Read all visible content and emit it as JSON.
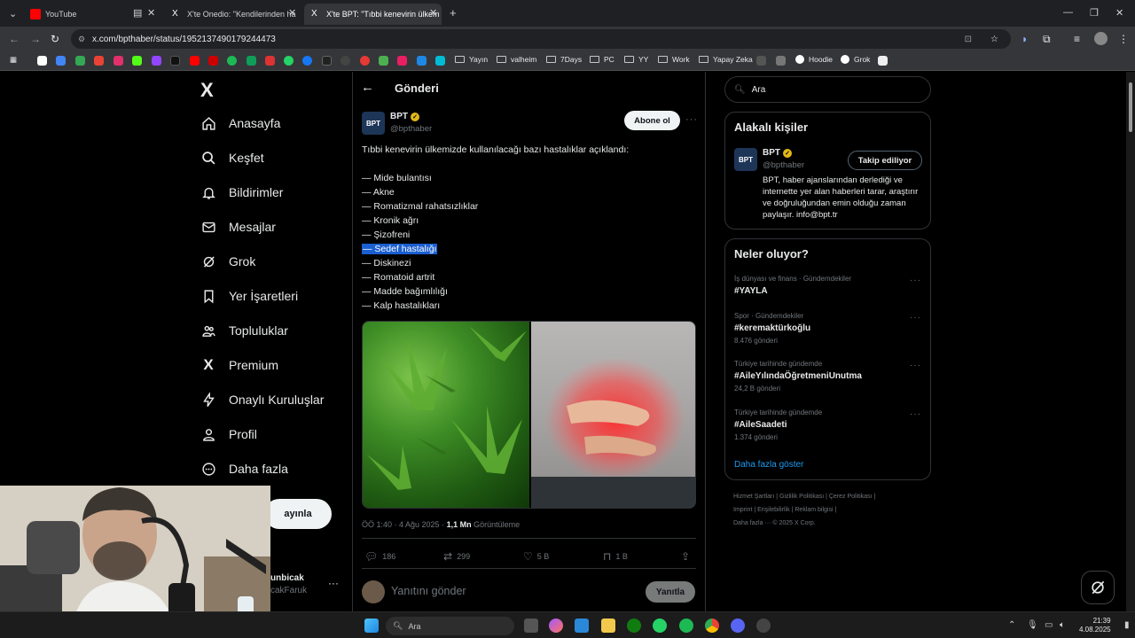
{
  "browser": {
    "tabs": [
      {
        "label": "YouTube",
        "favicon_color": "#ff0000"
      },
      {
        "label": "X'te Onedio: \"Kendilerinden ha",
        "favicon_color": "#ffffff"
      },
      {
        "label": "X'te BPT: \"Tıbbi kenevirin ülkem",
        "favicon_color": "#ffffff"
      }
    ],
    "new_tab_symbol": "+",
    "url": "x.com/bpthaber/status/1952137490179244473",
    "bookmarks": [
      "Yayın",
      "valheim",
      "7Days",
      "PC",
      "YY",
      "Work",
      "Yapay Zeka",
      "Hoodie",
      "Grok"
    ]
  },
  "sidebar": {
    "logo": "X",
    "items": [
      {
        "label": "Anasayfa",
        "icon": "home-icon"
      },
      {
        "label": "Keşfet",
        "icon": "search-icon"
      },
      {
        "label": "Bildirimler",
        "icon": "bell-icon"
      },
      {
        "label": "Mesajlar",
        "icon": "mail-icon"
      },
      {
        "label": "Grok",
        "icon": "grok-icon"
      },
      {
        "label": "Yer İşaretleri",
        "icon": "bookmark-icon"
      },
      {
        "label": "Topluluklar",
        "icon": "people-icon"
      },
      {
        "label": "Premium",
        "icon": "x-icon"
      },
      {
        "label": "Onaylı Kuruluşlar",
        "icon": "lightning-icon"
      },
      {
        "label": "Profil",
        "icon": "user-icon"
      },
      {
        "label": "Daha fazla",
        "icon": "more-circle-icon"
      }
    ],
    "post_button": "ayınla",
    "account_name": "unbicak",
    "account_handle": "cakFaruk"
  },
  "main": {
    "header_title": "Gönderi",
    "tweet": {
      "name": "BPT",
      "handle": "@bpthaber",
      "follow_label": "Abone ol",
      "intro": "Tıbbi kenevirin ülkemizde kullanılacağı bazı hastalıklar açıklandı:",
      "list": [
        "— Mide bulantısı",
        "— Akne",
        "— Romatizmal rahatsızlıklar",
        "— Kronik ağrı",
        "— Şizofreni",
        "— Sedef hastalığı",
        "— Diskinezi",
        "— Romatoid artrit",
        "— Madde bağımlılığı",
        "— Kalp hastalıkları"
      ],
      "selected_index": 5,
      "time": "ÖÖ 1:40 · 4 Ağu 2025 · ",
      "views_count": "1,1 Mn",
      "views_label": " Görüntüleme",
      "replies": "186",
      "reposts": "299",
      "likes": "5 B",
      "bookmarks": "1 B"
    },
    "reply_placeholder": "Yanıtını gönder",
    "reply_button": "Yanıtla"
  },
  "right": {
    "search_placeholder": "Ara",
    "relevant_title": "Alakalı kişiler",
    "relevant_person": {
      "name": "BPT",
      "handle": "@bpthaber",
      "follow_label": "Takip ediliyor",
      "bio": "BPT, haber ajanslarından derlediği ve internette yer alan haberleri tarar, araştırır ve doğruluğundan emin olduğu zaman paylaşır. info@bpt.tr"
    },
    "trends_title": "Neler oluyor?",
    "trends": [
      {
        "category": "İş dünyası ve finans · Gündemdekiler",
        "name": "#YAYLA",
        "count": ""
      },
      {
        "category": "Spor · Gündemdekiler",
        "name": "#keremaktürkoğlu",
        "count": "8.476 gönderi"
      },
      {
        "category": "Türkiye tarihinde gündemde",
        "name": "#AileYılındaÖğretmeniUnutma",
        "count": "24,2 B gönderi"
      },
      {
        "category": "Türkiye tarihinde gündemde",
        "name": "#AileSaadeti",
        "count": "1.374 gönderi"
      }
    ],
    "show_more": "Daha fazla göster",
    "footer_line1": "Hizmet Şartları  |  Gizlilik Politikası  |  Çerez Politikası  |",
    "footer_line2": "Imprint  |  Erişilebilirlik  |  Reklam bilgisi  |",
    "footer_line3": "Daha fazla ···   © 2025 X Corp."
  },
  "taskbar": {
    "search_placeholder": "Ara",
    "time": "21:39",
    "date": "4.08.2025"
  },
  "colors": {
    "accent": "#1d9bf0",
    "selection": "#1a5fd2",
    "verified": "#e2b719"
  }
}
